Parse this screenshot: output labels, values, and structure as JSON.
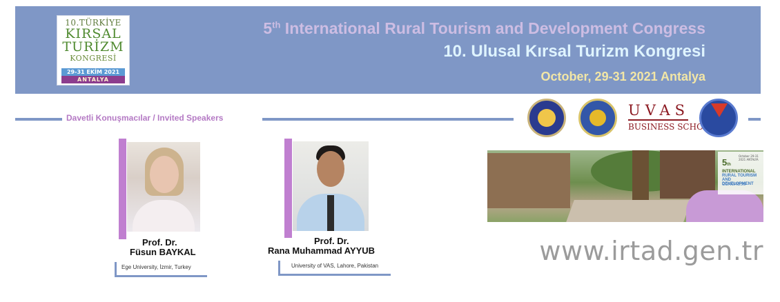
{
  "header": {
    "logo": {
      "line1": "10.TÜRKİYE",
      "line2": "KIRSAL",
      "line3": "TURİZM",
      "line4": "KONGRESİ",
      "dates": "29-31 EKİM 2021",
      "city": "ANTALYA"
    },
    "title_num": "5",
    "title_sup": "th",
    "title_rest": " International Rural Tourism and Development Congress",
    "subtitle": "10. Ulusal Kırsal Turizm Kongresi",
    "date_line": "October, 29-31 2021 Antalya"
  },
  "section": {
    "title": "Davetli Konuşmacılar /  Invited Speakers"
  },
  "sponsors": {
    "uvas_word": "UVAS",
    "uvas_sub": "BUSINESS SCHOOL"
  },
  "speakers": [
    {
      "title": "Prof. Dr.",
      "name": "Füsun BAYKAL",
      "affiliation": "Ege University, İzmir, Turkey"
    },
    {
      "title": "Prof. Dr.",
      "name": "Rana Muhammad AYYUB",
      "affiliation": "University of VAS, Lahore, Pakistan"
    }
  ],
  "congress_photo": {
    "num": "5",
    "sup": "th",
    "line1": "INTERNATIONAL",
    "line2": "RURAL TOURISM AND DEVELOPMENT",
    "line3": "CONGRESS",
    "date_small": "October 29-31 2021 ANTALYA"
  },
  "website": "www.irtad.gen.tr",
  "colors": {
    "banner": "#7f97c6",
    "accent_purple": "#c07fd0",
    "section_title": "#b479c4"
  }
}
